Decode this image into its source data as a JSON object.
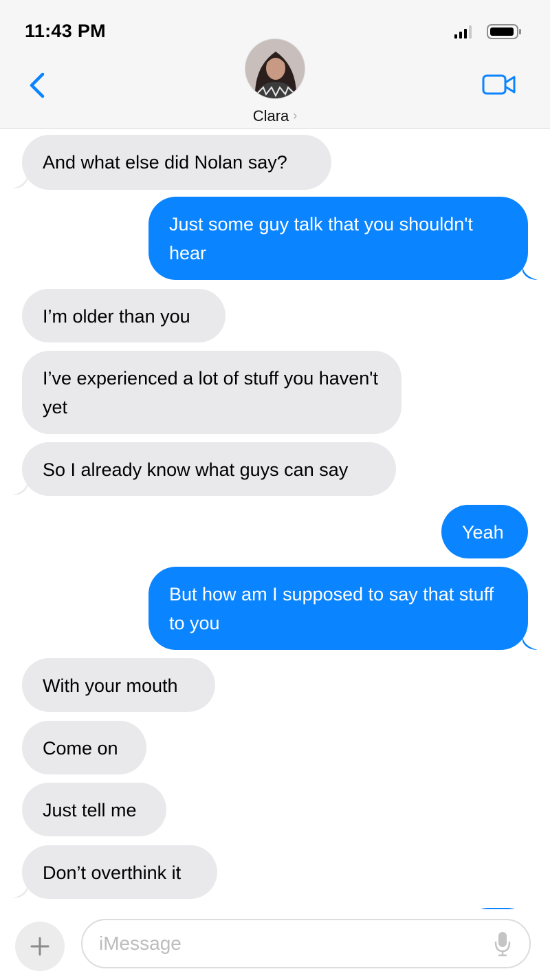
{
  "status_bar": {
    "time": "11:43 PM"
  },
  "header": {
    "contact_name": "Clara",
    "chevron": "›"
  },
  "messages": [
    {
      "sender": "them",
      "text": "And what else did Nolan say?"
    },
    {
      "sender": "me",
      "text": "Just some guy talk that you shouldn't hear"
    },
    {
      "sender": "them",
      "text": "I’m older than you"
    },
    {
      "sender": "them",
      "text": "I’ve experienced a lot of stuff you haven't yet"
    },
    {
      "sender": "them",
      "text": "So I already know what guys can say"
    },
    {
      "sender": "me",
      "text": "Yeah"
    },
    {
      "sender": "me",
      "text": "But how am I supposed to say that stuff to you"
    },
    {
      "sender": "them",
      "text": "With your mouth"
    },
    {
      "sender": "them",
      "text": "Come on"
    },
    {
      "sender": "them",
      "text": "Just tell me"
    },
    {
      "sender": "them",
      "text": "Don’t overthink it"
    }
  ],
  "composer": {
    "placeholder": "iMessage",
    "value": ""
  },
  "icons": {
    "back": "chevron-left-icon",
    "video": "video-camera-icon",
    "add": "plus-icon",
    "mic": "microphone-icon",
    "signal": "cellular-signal-icon",
    "battery": "battery-icon"
  },
  "colors": {
    "outgoing_bubble": "#0a84ff",
    "incoming_bubble": "#e9e9eb",
    "accent": "#0a84ff",
    "header_bg": "#f6f6f6"
  }
}
